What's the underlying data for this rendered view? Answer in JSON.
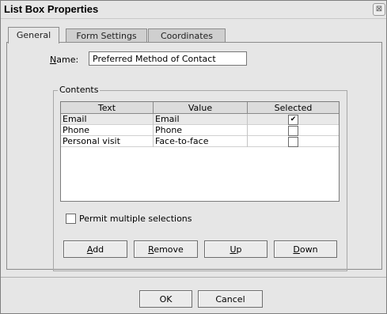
{
  "dialog": {
    "title": "List Box Properties",
    "close_glyph": "⊠"
  },
  "tabs": [
    {
      "label": "General",
      "active": true
    },
    {
      "label": "Form Settings",
      "active": false
    },
    {
      "label": "Coordinates",
      "active": false
    }
  ],
  "name_field": {
    "label": "Name:",
    "mnemonic": "N",
    "label_rest": "ame:",
    "value": "Preferred Method of Contact"
  },
  "contents": {
    "group_label": "Contents",
    "columns": [
      "Text",
      "Value",
      "Selected"
    ],
    "rows": [
      {
        "text": "Email",
        "value": "Email",
        "selected": true,
        "check_glyph": "✔"
      },
      {
        "text": "Phone",
        "value": "Phone",
        "selected": false,
        "check_glyph": ""
      },
      {
        "text": "Personal visit",
        "value": "Face-to-face",
        "selected": false,
        "check_glyph": ""
      }
    ],
    "permit_multiple": {
      "label": "Permit multiple selections",
      "checked": false
    }
  },
  "buttons": {
    "add": {
      "mnemonic": "A",
      "rest": "dd"
    },
    "remove": {
      "mnemonic": "R",
      "rest": "emove"
    },
    "up": {
      "mnemonic": "U",
      "rest": "p"
    },
    "down": {
      "mnemonic": "D",
      "rest": "own"
    }
  },
  "footer": {
    "ok": "OK",
    "cancel": "Cancel"
  }
}
